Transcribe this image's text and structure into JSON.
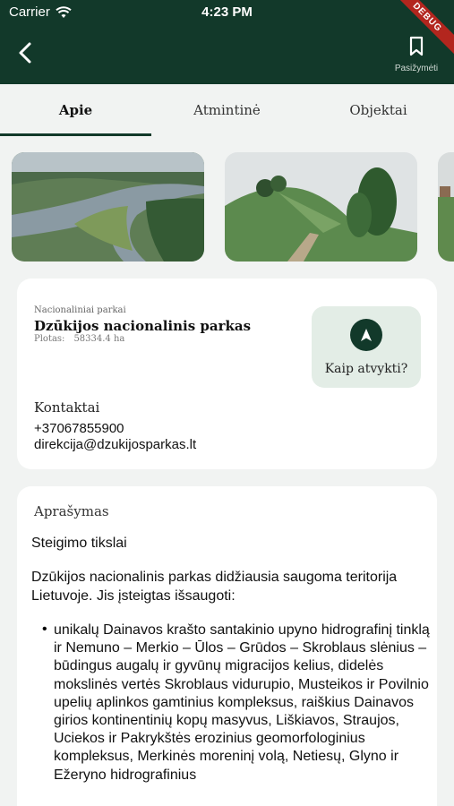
{
  "status_bar": {
    "carrier": "Carrier",
    "time": "4:23 PM"
  },
  "header": {
    "bookmark_label": "Pasižymėti",
    "debug_banner": "DEBUG"
  },
  "tabs": [
    {
      "label": "Apie",
      "active": true
    },
    {
      "label": "Atmintinė",
      "active": false
    },
    {
      "label": "Objektai",
      "active": false
    }
  ],
  "park": {
    "category": "Nacionaliniai parkai",
    "name": "Dzūkijos nacionalinis parkas",
    "area_label": "Plotas:",
    "area_value": "58334.4 ha",
    "directions_label": "Kaip atvykti?"
  },
  "contacts": {
    "title": "Kontaktai",
    "phone": "+37067855900",
    "email": "direkcija@dzukijosparkas.lt"
  },
  "description": {
    "title": "Aprašymas",
    "subtitle": "Steigimo tikslai",
    "paragraph": "Dzūkijos nacionalinis parkas didžiausia saugoma teritorija Lietuvoje. Jis įsteigtas išsaugoti:",
    "bullet": "unikalų Dainavos krašto santakinio upyno hidrografinį tinklą ir Nemuno – Merkio – Ūlos – Grūdos – Skroblaus slėnius – būdingus augalų ir gyvūnų migracijos kelius, didelės mokslinės vertės Skroblaus vidurupio, Musteikos ir Povilnio upelių aplinkos gamtinius kompleksus, raiškius Dainavos girios kontinentinių kopų masyvus, Liškiavos, Straujos, Uciekos ir Pakrykštės erozinius geomorfologinius kompleksus, Merkinės moreninį volą, Netiesų, Glyno ir Ežeryno hidrografinius"
  },
  "colors": {
    "primary": "#12392a",
    "directions_bg": "#e3ede6",
    "background": "#f1f3f2"
  }
}
